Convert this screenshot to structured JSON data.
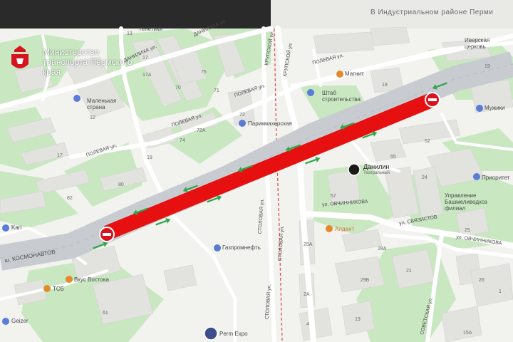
{
  "ministry": {
    "title": "Министерство транспорта Пермского края"
  },
  "top_text": "В Индустриальном районе Перми",
  "streets": {
    "kosmonavtov": "ш. КОСМОНАВТОВ",
    "polevaya_a": "ПОЛЕВАЯ ул.",
    "polevaya_b": "ПОЛЕВАЯ ул.",
    "polevaya_c": "ПОЛЕВАЯ ул.",
    "polevaya_d": "ПОЛЕВАЯ ул.",
    "danilikha": "ДАНИЛИХА ул.",
    "danilikha_b": "ДАНИЛИХА ул.",
    "krupskoy": "КРУПСКОЙ ул.",
    "krupskoy_b": "КРУПСКОЙ ул.",
    "stolovaya_a": "СТОЛОВАЯ ул.",
    "stolovaya_b": "СТОЛОВАЯ ул.",
    "stolovaya_c": "СТОЛОВАЯ ул.",
    "ovchinnikova_a": "ул. ОВЧИННИКОВА",
    "ovchinnikova_b": "ул. ОВЧИННИКОВА",
    "svyazistov": "ул. СВЯЗИСТОВ",
    "sovetskaya": "СОВЕТСКАЯ ул."
  },
  "pois": {
    "genetika": "генетики",
    "malenkaya_strana": "Маленькая страна",
    "magnit": "Магнит",
    "shtab": "Штаб строительства",
    "parikmakherskaya": "Парикмахерская",
    "iverskaya": "Иверская церковь",
    "muzhik": "Мужики",
    "danilin": "Данилин",
    "danilin_sub": "Театральный",
    "prioritet": "Приоритет",
    "upravlenie": "Управление Башмеливодхоз филиал",
    "aldent": "Алдент",
    "gazpromneft": "Газпромнефть",
    "vkus_vostoka": "Вкус Востока",
    "tsb": "ТСБ",
    "kari": "Kari",
    "geizer": "Geizer",
    "perm_expo": "Perm Expo"
  },
  "house_numbers": [
    "13",
    "17",
    "17A",
    "75",
    "71",
    "70",
    "12",
    "72",
    "72A",
    "17",
    "74",
    "19",
    "80",
    "82",
    "19",
    "19",
    "57",
    "55",
    "52",
    "28A",
    "24",
    "25",
    "29Б",
    "21",
    "26",
    "2А",
    "25А",
    "61",
    "4",
    "19",
    "15А",
    "1"
  ],
  "closure": {
    "segment": "ш. КОСМОНАВТОВ, closed segment",
    "from": "Sign 1",
    "to": "Sign 2"
  },
  "colors": {
    "background": "#f2f2ef",
    "park": "#c9e8c2",
    "road": "#ffffff",
    "highway": "#c8ccd1",
    "building": "#e2e2de",
    "closure": "#e61010",
    "arrow": "#2ea84b",
    "no_entry": "#d6141f",
    "railway": "#e05a5a",
    "pin_orange": "#e58a2b",
    "pin_blue": "#5a7bd6"
  },
  "icons": [
    "no-entry-icon",
    "direction-arrow-icon",
    "location-pin-icon",
    "coat-of-arms-icon"
  ]
}
